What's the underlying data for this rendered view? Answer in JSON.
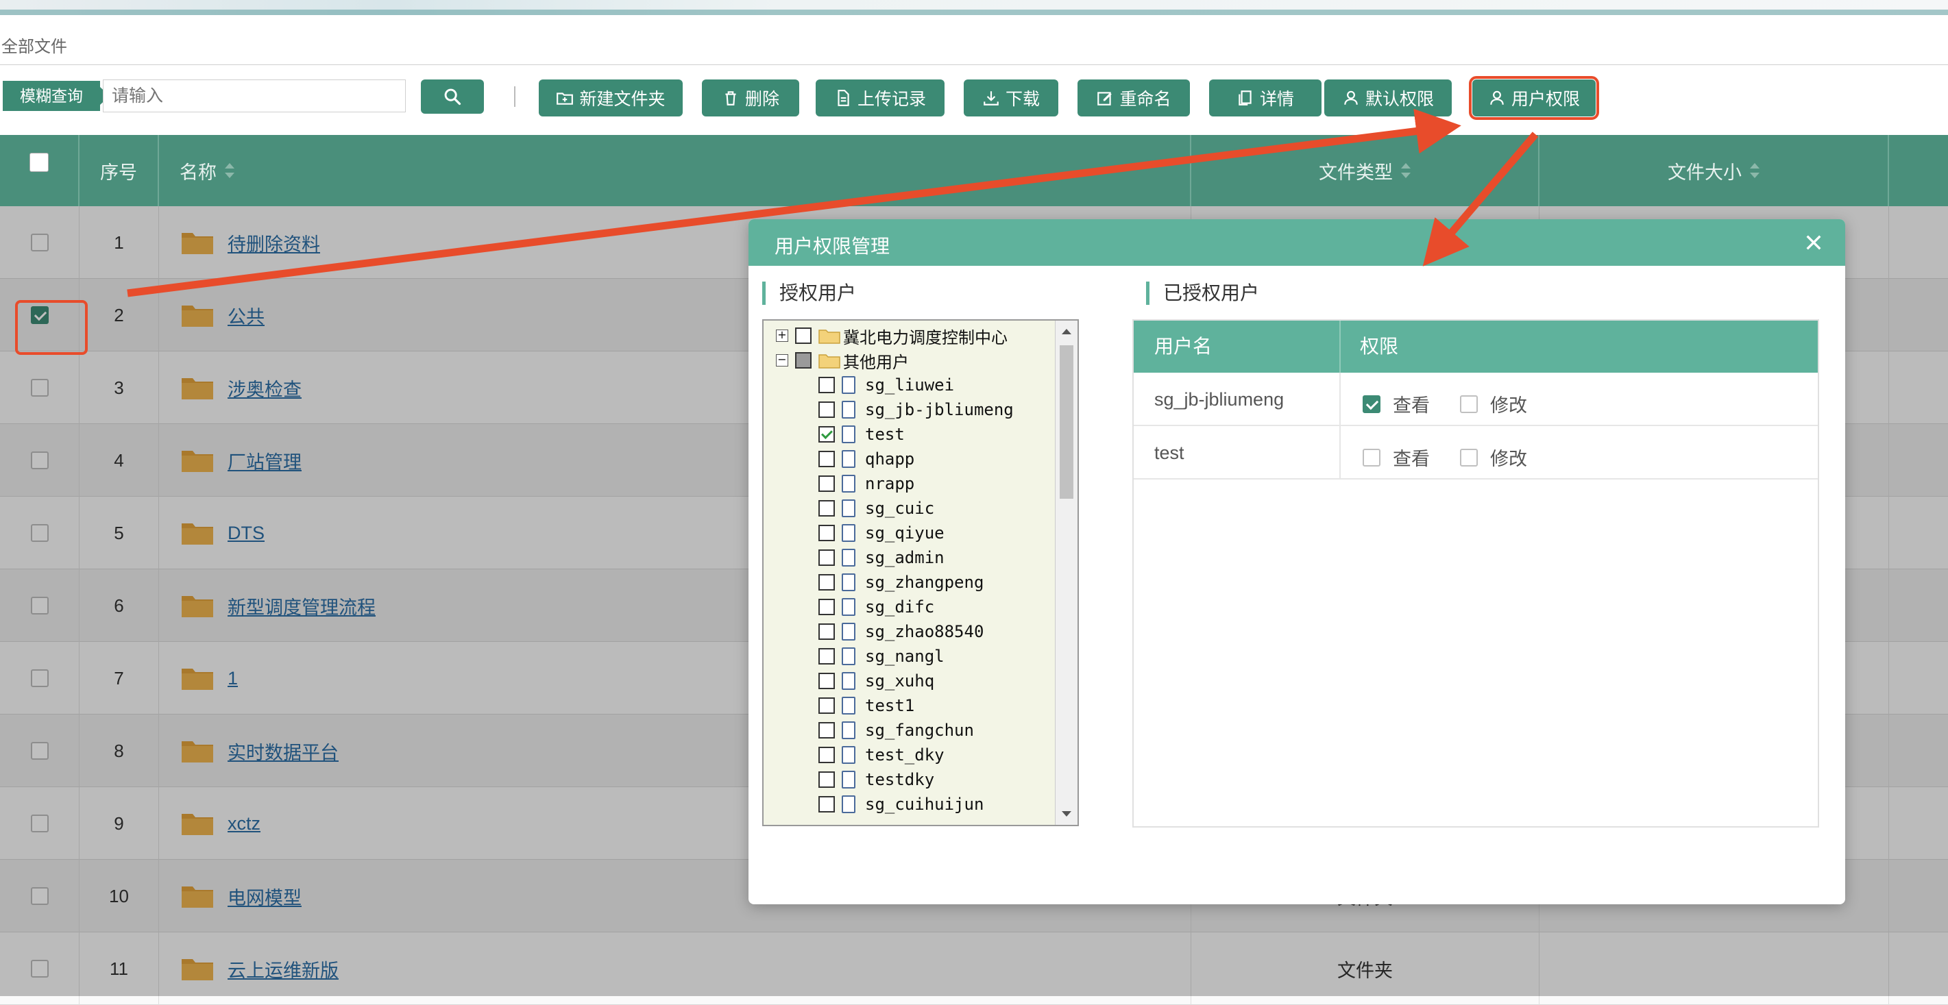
{
  "breadcrumb": "全部文件",
  "toolbar": {
    "search_tag": "模糊查询",
    "search_placeholder": "请输入",
    "buttons": {
      "new_folder": "新建文件夹",
      "delete": "删除",
      "upload_log": "上传记录",
      "download": "下载",
      "rename": "重命名",
      "details": "详情",
      "default_perm": "默认权限",
      "user_perm": "用户权限"
    }
  },
  "table": {
    "headers": {
      "index": "序号",
      "name": "名称",
      "type": "文件类型",
      "size": "文件大小"
    },
    "rows": [
      {
        "index": "1",
        "name": "待删除资料",
        "type": "",
        "checked": false
      },
      {
        "index": "2",
        "name": "公共",
        "type": "",
        "checked": true
      },
      {
        "index": "3",
        "name": "涉奥检查",
        "type": "",
        "checked": false
      },
      {
        "index": "4",
        "name": "厂站管理",
        "type": "",
        "checked": false
      },
      {
        "index": "5",
        "name": "DTS",
        "type": "",
        "checked": false
      },
      {
        "index": "6",
        "name": "新型调度管理流程",
        "type": "",
        "checked": false
      },
      {
        "index": "7",
        "name": "1",
        "type": "",
        "checked": false
      },
      {
        "index": "8",
        "name": "实时数据平台",
        "type": "",
        "checked": false
      },
      {
        "index": "9",
        "name": "xctz",
        "type": "",
        "checked": false
      },
      {
        "index": "10",
        "name": "电网模型",
        "type": "文件夹",
        "checked": false
      },
      {
        "index": "11",
        "name": "云上运维新版",
        "type": "文件夹",
        "checked": false
      }
    ]
  },
  "modal": {
    "title": "用户权限管理",
    "left_section": "授权用户",
    "right_section": "已授权用户",
    "tree": {
      "root1": "冀北电力调度控制中心",
      "root2": "其他用户",
      "users": [
        {
          "name": "sg_liuwei",
          "checked": false
        },
        {
          "name": "sg_jb-jbliumeng",
          "checked": false
        },
        {
          "name": "test",
          "checked": true
        },
        {
          "name": "qhapp",
          "checked": false
        },
        {
          "name": "nrapp",
          "checked": false
        },
        {
          "name": "sg_cuic",
          "checked": false
        },
        {
          "name": "sg_qiyue",
          "checked": false
        },
        {
          "name": "sg_admin",
          "checked": false
        },
        {
          "name": "sg_zhangpeng",
          "checked": false
        },
        {
          "name": "sg_difc",
          "checked": false
        },
        {
          "name": "sg_zhao88540",
          "checked": false
        },
        {
          "name": "sg_nangl",
          "checked": false
        },
        {
          "name": "sg_xuhq",
          "checked": false
        },
        {
          "name": "test1",
          "checked": false
        },
        {
          "name": "sg_fangchun",
          "checked": false
        },
        {
          "name": "test_dky",
          "checked": false
        },
        {
          "name": "testdky",
          "checked": false
        },
        {
          "name": "sg_cuihuijun",
          "checked": false
        }
      ]
    },
    "perm_table": {
      "headers": {
        "user": "用户名",
        "perm": "权限"
      },
      "view_label": "查看",
      "edit_label": "修改",
      "rows": [
        {
          "user": "sg_jb-jbliumeng",
          "view": true,
          "edit": false
        },
        {
          "user": "test",
          "view": false,
          "edit": false
        }
      ]
    }
  },
  "colors": {
    "primary": "#3c8a74",
    "header": "#4a8f7b",
    "modal_header": "#5fb29c",
    "annotation": "#e84c2b",
    "link": "#2b6ea6"
  }
}
